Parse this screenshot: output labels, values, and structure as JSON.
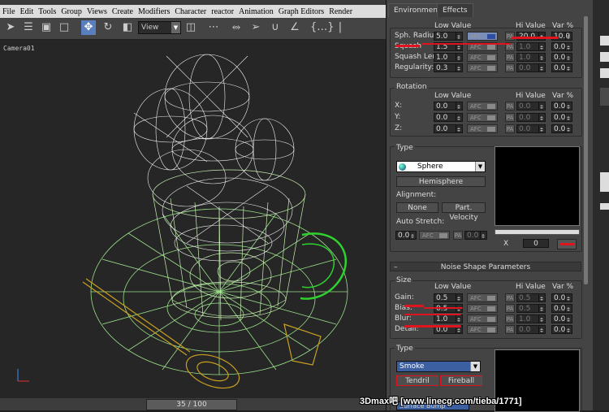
{
  "menubar": [
    "File",
    "Edit",
    "Tools",
    "Group",
    "Views",
    "Create",
    "Modifiers",
    "Character",
    "reactor",
    "Animation",
    "Graph Editors",
    "Render"
  ],
  "toolbar": {
    "view_select": "View"
  },
  "viewport": {
    "label": "Camera01"
  },
  "timeline": {
    "frame": "35 / 100"
  },
  "tabs": [
    "Environment",
    "Effects"
  ],
  "table_headers": {
    "low": "Low Value",
    "hi": "Hi Value",
    "var": "Var %"
  },
  "afc_label": "AFC",
  "pa_label": "PA",
  "shape": {
    "rows": [
      {
        "label": "Sph. Radius:",
        "low": "5.0",
        "hi": "20.0",
        "var": "10.0"
      },
      {
        "label": "Squash",
        "low": "1.5",
        "hi": "1.0",
        "var": "0.0"
      },
      {
        "label": "Squash Len:",
        "low": "1.0",
        "hi": "1.0",
        "var": "0.0"
      },
      {
        "label": "Regularity:",
        "low": "0.3",
        "hi": "0.0",
        "var": "0.0"
      }
    ]
  },
  "rotation": {
    "title": "Rotation",
    "rows": [
      {
        "label": "X:",
        "low": "0.0",
        "hi": "0.0",
        "var": "0.0"
      },
      {
        "label": "Y:",
        "low": "0.0",
        "hi": "0.0",
        "var": "0.0"
      },
      {
        "label": "Z:",
        "low": "0.0",
        "hi": "0.0",
        "var": "0.0"
      }
    ]
  },
  "type1": {
    "title": "Type",
    "dropdown": "Sphere",
    "hemisphere_button": "Hemisphere",
    "alignment_label": "Alignment:",
    "none_button": "None",
    "part_velocity_button": "Part. Velocity",
    "auto_stretch_label": "Auto Stretch:",
    "auto_stretch_value": "0.0",
    "auto_stretch_pa": "0.0",
    "preview_x": "X",
    "preview_value": "0"
  },
  "noise_rollout": "Noise Shape Parameters",
  "size": {
    "title": "Size",
    "rows": [
      {
        "label": "Gain:",
        "low": "0.5",
        "hi": "0.5",
        "var": "0.0"
      },
      {
        "label": "Bias:",
        "low": "0.5",
        "hi": "0.5",
        "var": "0.0"
      },
      {
        "label": "Blur:",
        "low": "1.0",
        "hi": "1.0",
        "var": "0.0"
      },
      {
        "label": "Detail:",
        "low": "0.0",
        "hi": "0.0",
        "var": "0.0"
      }
    ]
  },
  "type2": {
    "title": "Type",
    "dropdown": "Smoke",
    "tendril_button": "Tendril",
    "fireball_button": "Fireball",
    "partial_dropdown": "Surface Bump"
  },
  "watermark": "3Dmax吧  [www.linecg.com/tieba/1771]",
  "colors": {
    "accent_red": "#e0141e",
    "wire_white": "#f0f0f0",
    "wire_green": "#9be08a",
    "wire_gold": "#c9a020",
    "active_tool": "#5a7fbf"
  }
}
